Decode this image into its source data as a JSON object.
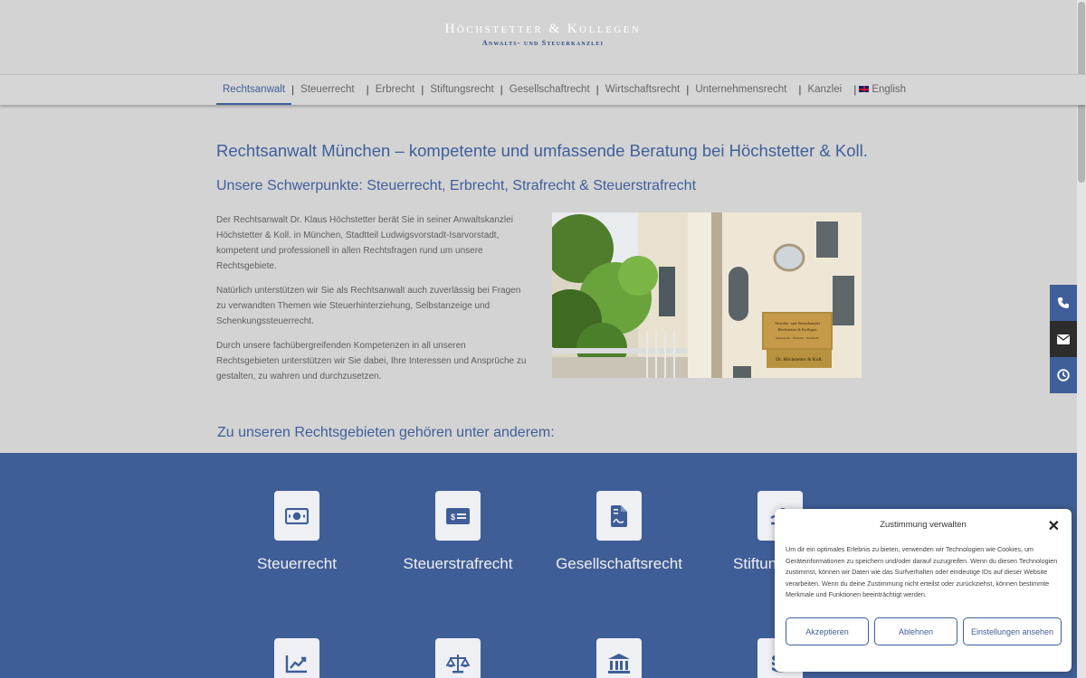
{
  "header": {
    "logo_main": "Höchstetter & Kollegen",
    "logo_sub": "Anwalts- und Steuerkanzlei"
  },
  "nav": {
    "items": [
      {
        "label": "Rechtsanwalt"
      },
      {
        "label": "Steuerrecht"
      },
      {
        "label": "Erbrecht"
      },
      {
        "label": "Stiftungsrecht"
      },
      {
        "label": "Gesellschaftrecht"
      },
      {
        "label": "Wirtschaftsrecht"
      },
      {
        "label": "Unternehmensrecht"
      },
      {
        "label": "Kanzlei"
      },
      {
        "label": "English"
      }
    ],
    "separator": "|"
  },
  "main": {
    "title": "Rechtsanwalt München – kompetente und umfassende Beratung bei Höchstetter & Koll.",
    "subtitle": "Unsere Schwerpunkte: Steuerrecht, Erbrecht, Strafrecht & Steuerstrafrecht",
    "paragraphs": [
      "Der Rechtsanwalt Dr. Klaus Höchstetter berät Sie in seiner Anwaltskanzlei Höchstetter & Koll. in München, Stadtteil Ludwigsvorstadt-Isarvorstadt, kompetent und professionell in allen Rechtsfragen rund um unsere Rechtsgebiete.",
      "Natürlich unterstützen wir Sie als Rechtsanwalt auch zuverlässig bei Fragen zu verwandten Themen wie Steuerhinterziehung, Selbstanzeige und Schenkungssteuerrecht.",
      "Durch unsere fachübergreifenden Kompetenzen in all unseren Rechtsgebieten unterstützen wir Sie dabei, Ihre Interessen und Ansprüche zu gestalten, zu wahren und durchzusetzen."
    ],
    "photo_sign": {
      "line1": "Anwalts- und Steuerkanzlei",
      "line2": "Höchstetter & Kollegen",
      "line3": "Steuerrecht · Erbrecht · Strafrecht",
      "plate": "Dr. Höchstetter & Koll."
    },
    "areas_heading": "Zu unseren Rechtsgebieten gehören unter anderem:"
  },
  "areas": [
    {
      "label": "Steuerrecht",
      "icon": "money-bill-icon"
    },
    {
      "label": "Steuerstrafrecht",
      "icon": "money-check-icon"
    },
    {
      "label": "Gesellschaftsrecht",
      "icon": "file-contract-icon"
    },
    {
      "label": "Stiftungsrecht",
      "icon": "hand-holding-icon"
    }
  ],
  "areas_row2_icons": [
    "chart-line-icon",
    "balance-scale-icon",
    "landmark-icon",
    "coins-icon"
  ],
  "consent": {
    "title": "Zustimmung verwalten",
    "text": "Um dir ein optimales Erlebnis zu bieten, verwenden wir Technologien wie Cookies, um Geräteinformationen zu speichern und/oder darauf zuzugreifen. Wenn du diesen Technologien zustimmst, können wir Daten wie das Surfverhalten oder eindeutige IDs auf dieser Website verarbeiten. Wenn du deine Zustimmung nicht erteilst oder zurückziehst, können bestimmte Merkmale und Funktionen beeinträchtigt werden.",
    "accept": "Akzeptieren",
    "deny": "Ablehnen",
    "settings": "Einstellungen ansehen"
  },
  "colors": {
    "accent": "#3e5f9a",
    "band": "#3f5e97",
    "background": "#d3d3d3"
  }
}
